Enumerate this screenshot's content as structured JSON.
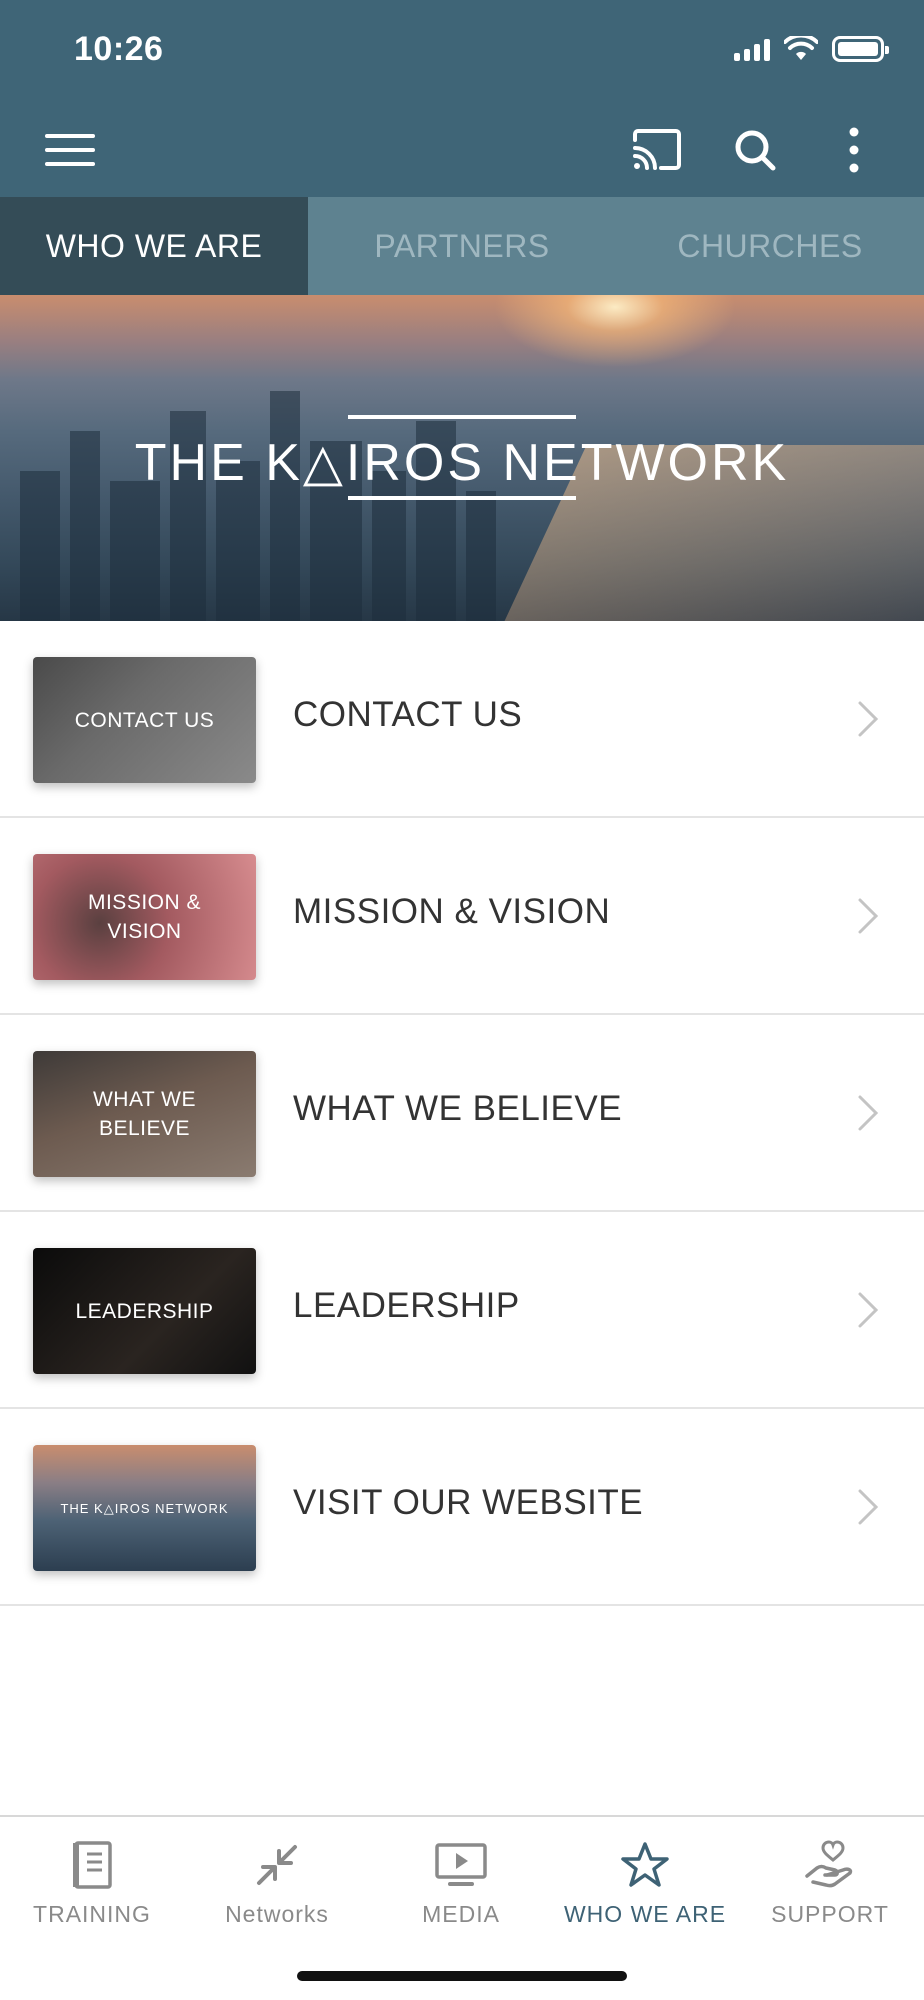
{
  "status_bar": {
    "time": "10:26"
  },
  "toolbar": {
    "menu_icon": "hamburger-menu-icon",
    "cast_icon": "cast-icon",
    "search_icon": "search-icon",
    "more_icon": "more-vertical-icon"
  },
  "tabs": [
    {
      "label": "WHO WE ARE",
      "active": true
    },
    {
      "label": "PARTNERS",
      "active": false
    },
    {
      "label": "CHURCHES",
      "active": false
    }
  ],
  "hero": {
    "title": "THE K△IROS NETWORK"
  },
  "list": [
    {
      "thumb_text": "CONTACT US",
      "label": "CONTACT US"
    },
    {
      "thumb_text": "MISSION & VISION",
      "label": "MISSION & VISION"
    },
    {
      "thumb_text": "WHAT WE BELIEVE",
      "label": "WHAT WE BELIEVE"
    },
    {
      "thumb_text": "LEADERSHIP",
      "label": "LEADERSHIP"
    },
    {
      "thumb_text": "THE K△IROS NETWORK",
      "label": "VISIT OUR WEBSITE"
    }
  ],
  "bottom_nav": [
    {
      "label": "TRAINING",
      "icon": "book-icon",
      "active": false
    },
    {
      "label": "Networks",
      "icon": "collapse-arrows-icon",
      "active": false
    },
    {
      "label": "MEDIA",
      "icon": "play-screen-icon",
      "active": false
    },
    {
      "label": "WHO WE ARE",
      "icon": "star-icon",
      "active": true
    },
    {
      "label": "SUPPORT",
      "icon": "heart-hand-icon",
      "active": false
    }
  ],
  "colors": {
    "header": "#3f6577",
    "tab_bar": "#5e8290",
    "tab_active": "#344c57",
    "nav_active": "#3e6275"
  }
}
